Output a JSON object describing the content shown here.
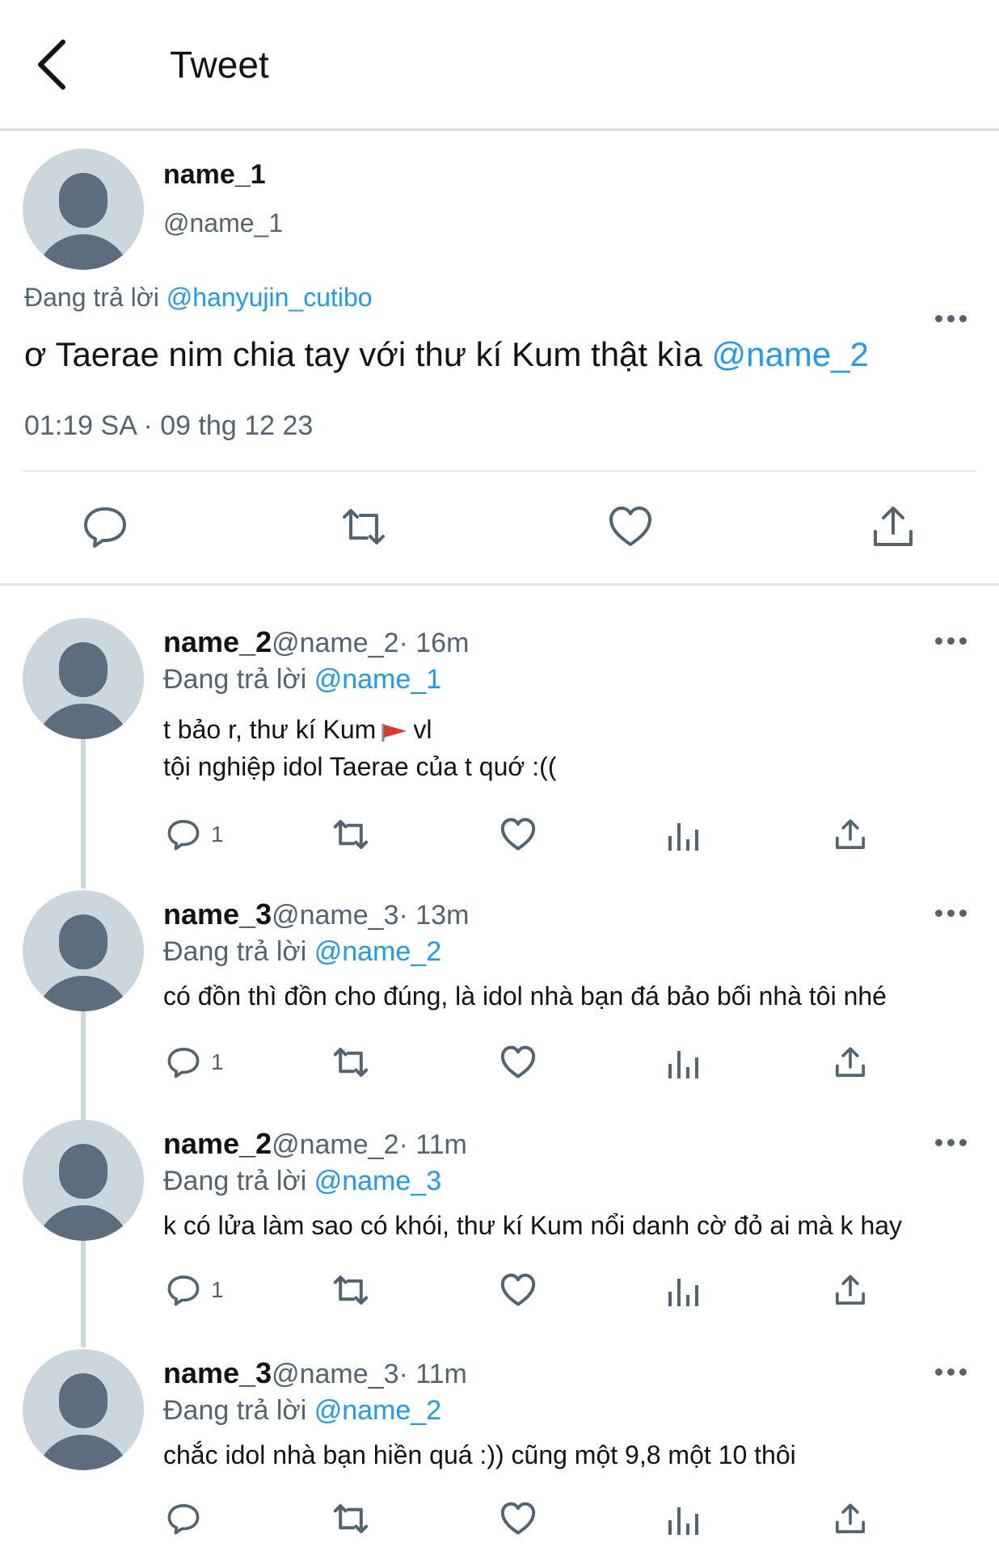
{
  "header": {
    "title": "Tweet"
  },
  "main_tweet": {
    "name": "name_1",
    "handle": "@name_1",
    "replying_label": "Đang trả lời",
    "replying_to": "@hanyujin_cutibo",
    "text": "ơ Taerae nim chia tay với thư kí Kum thật kìa",
    "mention": "@name_2",
    "meta": "01:19 SA · 09 thg 12 23",
    "actions": [
      "reply-icon",
      "retweet-icon",
      "like-icon",
      "share-icon"
    ]
  },
  "replies": [
    {
      "name": "name_2",
      "handle": "@name_2",
      "time": "· 16m",
      "replying_label": "Đang trả lời",
      "replying_to": "@name_1",
      "lines": [
        "t bảo r, thư kí Kum",
        "vl",
        "tội nghiệp idol Taerae của t quớ :(("
      ],
      "emoji": "red-flag-icon",
      "reply_count": "1"
    },
    {
      "name": "name_3",
      "handle": "@name_3",
      "time": "· 13m",
      "replying_label": "Đang trả lời",
      "replying_to": "@name_2",
      "lines": [
        "có đồn thì đồn cho đúng, là idol nhà bạn đá bảo bối nhà tôi nhé"
      ],
      "reply_count": "1"
    },
    {
      "name": "name_2",
      "handle": "@name_2",
      "time": "· 11m",
      "replying_label": "Đang trả lời",
      "replying_to": "@name_3",
      "lines": [
        "k có lửa làm sao có khói, thư kí Kum nổi danh cờ đỏ ai mà k hay"
      ],
      "reply_count": "1"
    },
    {
      "name": "name_3",
      "handle": "@name_3",
      "time": "· 11m",
      "replying_label": "Đang trả lời",
      "replying_to": "@name_2",
      "lines": [
        "chắc idol nhà bạn hiền quá :)) cũng một 9,8 một 10 thôi"
      ],
      "reply_count": ""
    }
  ],
  "colors": {
    "link": "#1d9bf0",
    "muted": "#536471",
    "avatar_bg": "#ccd6dd",
    "avatar_fg": "#5c6e7e"
  }
}
